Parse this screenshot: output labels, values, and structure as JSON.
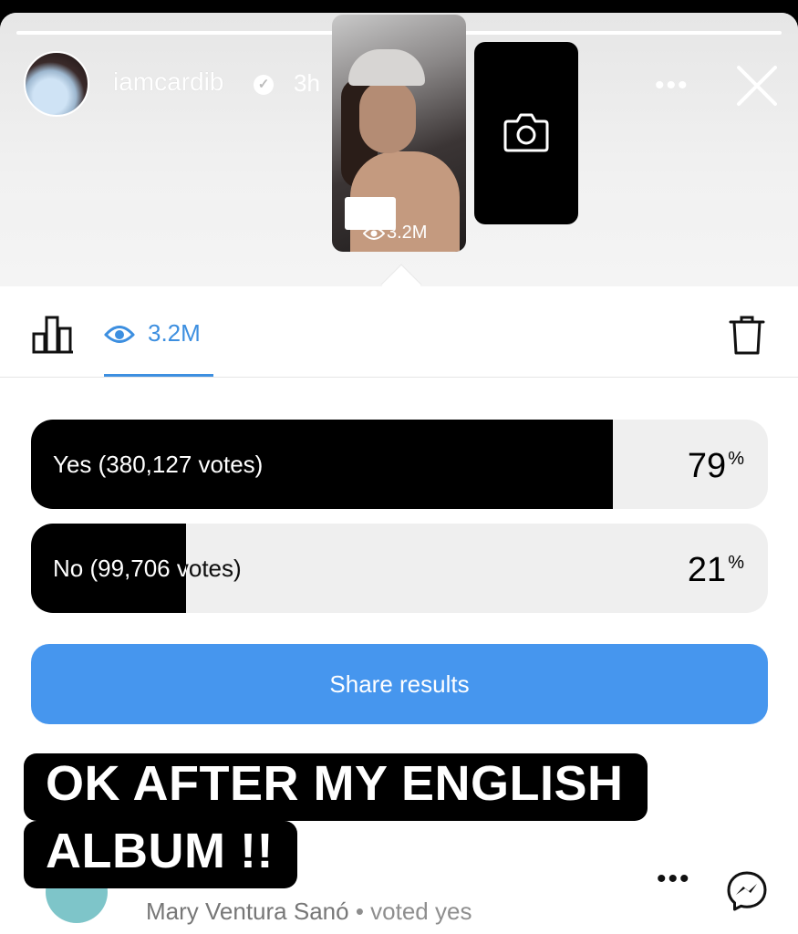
{
  "story": {
    "username": "iamcardib",
    "time_ago": "3h",
    "progress_segments": 2,
    "thumbnail_views": "3.2M"
  },
  "toolbar": {
    "views": "3.2M"
  },
  "poll": {
    "options": [
      {
        "label": "Yes (380,127 votes)",
        "percent": "79",
        "fill_fraction": 0.79
      },
      {
        "label": "No (99,706 votes)",
        "percent": "21",
        "fill_fraction": 0.21
      }
    ],
    "percent_symbol": "%"
  },
  "share_button": "Share results",
  "voter": {
    "name": "Mary Ventura Sanó",
    "separator": "•",
    "status": "voted yes"
  },
  "caption": {
    "line1": "OK AFTER MY ENGLISH",
    "line2": "ALBUM !!"
  },
  "colors": {
    "accent_blue": "#4696ee",
    "views_blue": "#3d8fe0",
    "poll_fill": "#000000",
    "poll_track": "#efefef"
  },
  "icons": [
    "verified-badge-icon",
    "more-icon",
    "close-icon",
    "camera-icon",
    "eye-icon",
    "bar-chart-icon",
    "trash-icon",
    "messenger-icon"
  ]
}
